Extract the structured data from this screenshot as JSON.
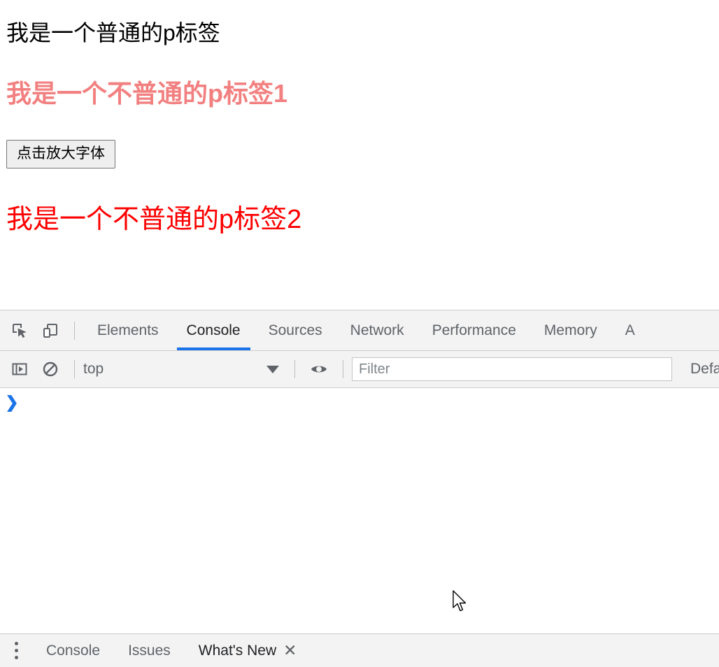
{
  "page": {
    "paragraph_normal": "我是一个普通的p标签",
    "paragraph_special_1": "我是一个不普通的p标签1",
    "paragraph_special_2": "我是一个不普通的p标签2",
    "button_label": "点击放大字体",
    "colors": {
      "normal_text": "#000000",
      "special_1_text": "#f28080",
      "special_2_text": "#fe0000",
      "button_bg": "#efefef",
      "button_border": "#767676"
    }
  },
  "devtools": {
    "accent_color": "#1a73e8",
    "toolbar_bg": "#f3f3f3",
    "border_color": "#cdcdcd",
    "icons": {
      "inspect": "inspect-element-icon",
      "device": "device-toolbar-icon",
      "sidebar": "console-sidebar-toggle-icon",
      "clear": "clear-console-icon",
      "eye": "live-expression-eye-icon"
    },
    "tabs": [
      {
        "label": "Elements",
        "active": false
      },
      {
        "label": "Console",
        "active": true
      },
      {
        "label": "Sources",
        "active": false
      },
      {
        "label": "Network",
        "active": false
      },
      {
        "label": "Performance",
        "active": false
      },
      {
        "label": "Memory",
        "active": false
      },
      {
        "label": "A",
        "active": false
      }
    ],
    "console_toolbar": {
      "context_value": "top",
      "filter_placeholder": "Filter",
      "filter_value": "",
      "levels_label": "Defa"
    },
    "console_body": {
      "prompt_caret": "❯"
    },
    "drawer": {
      "menu_icon": "more-options-kebab-icon",
      "tabs": [
        {
          "label": "Console",
          "active": false
        },
        {
          "label": "Issues",
          "active": false
        },
        {
          "label": "What's New",
          "active": true
        }
      ],
      "close_label": "✕"
    }
  }
}
